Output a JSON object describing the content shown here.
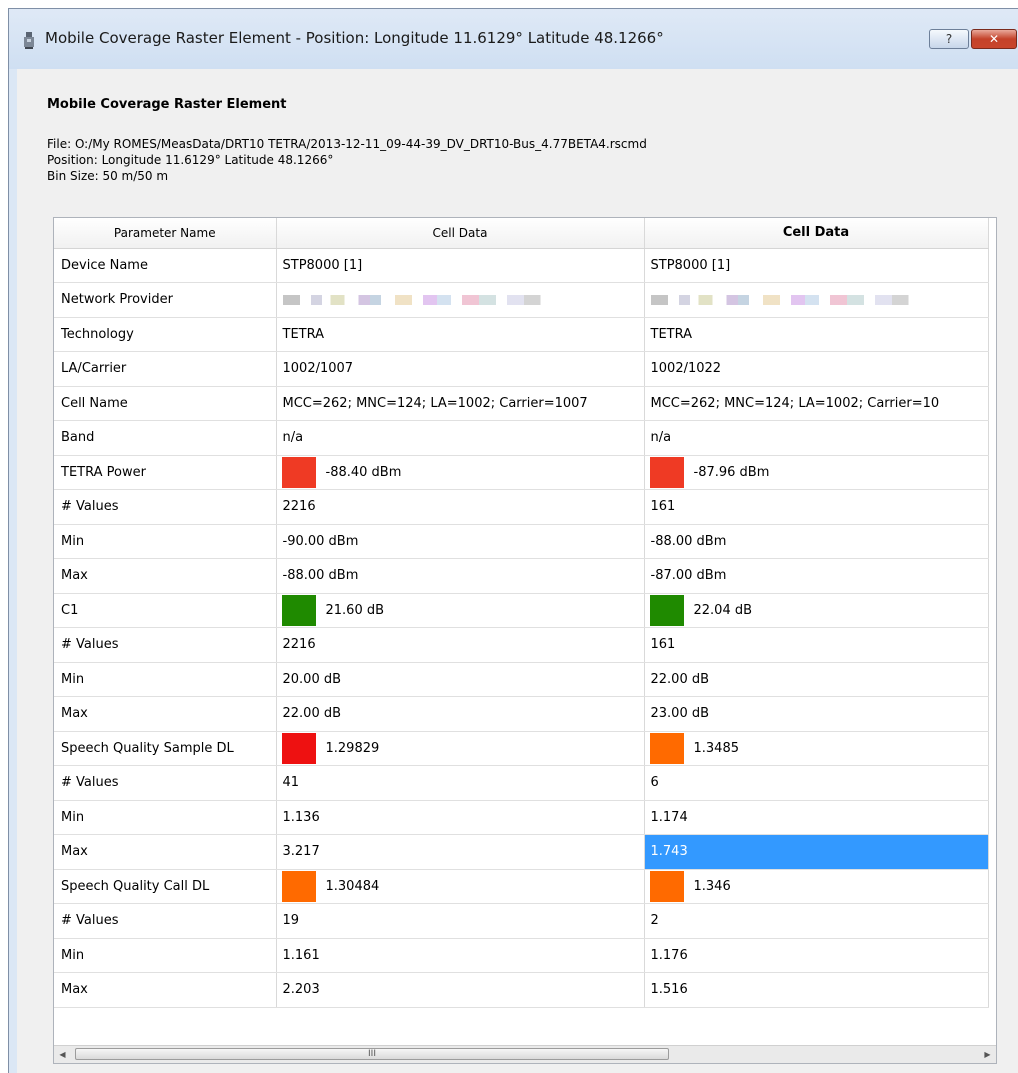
{
  "window": {
    "title": "Mobile Coverage Raster Element - Position: Longitude 11.6129° Latitude 48.1266°",
    "help_label": "?",
    "close_label": "✕"
  },
  "info": {
    "heading": "Mobile Coverage Raster Element",
    "file": "File: O:/My ROMES/MeasData/DRT10 TETRA/2013-12-11_09-44-39_DV_DRT10-Bus_4.77BETA4.rscmd",
    "position": "Position: Longitude 11.6129° Latitude 48.1266°",
    "bin_size": "Bin Size: 50 m/50 m"
  },
  "table": {
    "headers": [
      "Parameter Name",
      "Cell Data",
      "Cell Data"
    ],
    "rows": [
      {
        "name": "Device Name",
        "c1": "STP8000 [1]",
        "c2": "STP8000 [1]"
      },
      {
        "name": "Network Provider",
        "c1": "",
        "c2": "",
        "blurred": true
      },
      {
        "name": "Technology",
        "c1": "TETRA",
        "c2": "TETRA"
      },
      {
        "name": "LA/Carrier",
        "c1": "1002/1007",
        "c2": "1002/1022"
      },
      {
        "name": "Cell Name",
        "c1": "MCC=262; MNC=124; LA=1002; Carrier=1007",
        "c2": "MCC=262; MNC=124; LA=1002; Carrier=10"
      },
      {
        "name": "Band",
        "c1": "n/a",
        "c2": "n/a"
      },
      {
        "name": "TETRA Power",
        "c1": "-88.40 dBm",
        "c2": "-87.96 dBm",
        "s1": "#ef3a24",
        "s2": "#ef3a24"
      },
      {
        "name": "# Values",
        "c1": "2216",
        "c2": "161"
      },
      {
        "name": "Min",
        "c1": "-90.00 dBm",
        "c2": "-88.00 dBm"
      },
      {
        "name": "Max",
        "c1": "-88.00 dBm",
        "c2": "-87.00 dBm"
      },
      {
        "name": "C1",
        "c1": "21.60 dB",
        "c2": "22.04 dB",
        "s1": "#1f8a00",
        "s2": "#1f8a00"
      },
      {
        "name": "# Values",
        "c1": "2216",
        "c2": "161"
      },
      {
        "name": "Min",
        "c1": "20.00 dB",
        "c2": "22.00 dB"
      },
      {
        "name": "Max",
        "c1": "22.00 dB",
        "c2": "23.00 dB"
      },
      {
        "name": "Speech Quality Sample DL",
        "c1": "1.29829",
        "c2": "1.3485",
        "s1": "#ee1111",
        "s2": "#ff6a00"
      },
      {
        "name": "# Values",
        "c1": "41",
        "c2": "6"
      },
      {
        "name": "Min",
        "c1": "1.136",
        "c2": "1.174"
      },
      {
        "name": "Max",
        "c1": "3.217",
        "c2": "1.743",
        "selected2": true
      },
      {
        "name": "Speech Quality Call DL",
        "c1": "1.30484",
        "c2": "1.346",
        "s1": "#ff6a00",
        "s2": "#ff6a00"
      },
      {
        "name": "# Values",
        "c1": "19",
        "c2": "2"
      },
      {
        "name": "Min",
        "c1": "1.161",
        "c2": "1.176"
      },
      {
        "name": "Max",
        "c1": "2.203",
        "c2": "1.516"
      }
    ]
  },
  "scrollbar": {
    "left_arrow": "◀",
    "right_arrow": "▶",
    "grip": "III"
  }
}
